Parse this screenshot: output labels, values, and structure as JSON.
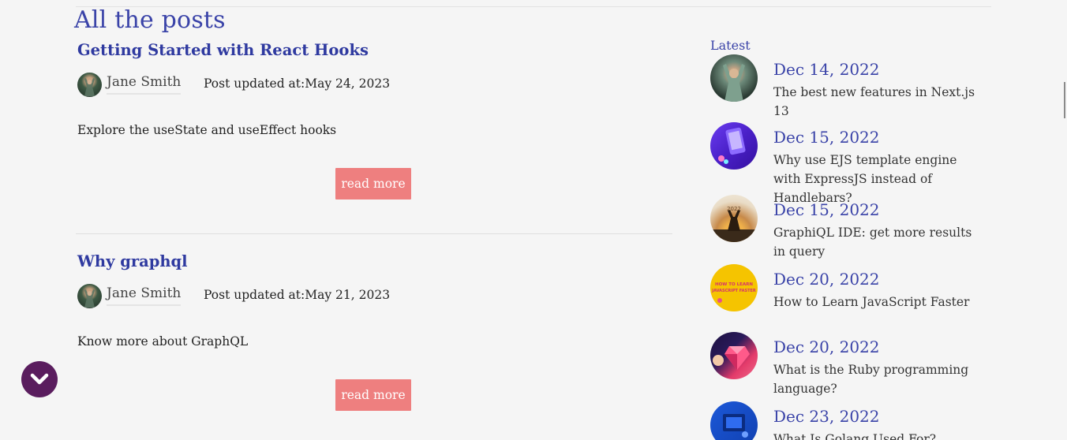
{
  "page": {
    "title": "All the posts"
  },
  "posts": [
    {
      "title": "Getting Started with React Hooks",
      "author": "Jane Smith",
      "updated": "Post updated at:May 24, 2023",
      "excerpt": "Explore the useState and useEffect hooks",
      "button": "read more"
    },
    {
      "title": "Why graphql",
      "author": "Jane Smith",
      "updated": "Post updated at:May 21, 2023",
      "excerpt": "Know more about GraphQL",
      "button": "read more"
    }
  ],
  "sidebar": {
    "label": "Latest",
    "items": [
      {
        "date": "Dec 14, 2022",
        "title": "The best new features in Next.js 13"
      },
      {
        "date": "Dec 15, 2022",
        "title": "Why use EJS template engine with ExpressJS instead of Handlebars?"
      },
      {
        "date": "Dec 15, 2022",
        "title": "GraphiQL IDE: get more results in query"
      },
      {
        "date": "Dec 20, 2022",
        "title": "How to Learn JavaScript Faster"
      },
      {
        "date": "Dec 20, 2022",
        "title": "What is the Ruby programming language?"
      },
      {
        "date": "Dec 23, 2022",
        "title": "What Is Golang Used For?"
      }
    ]
  },
  "thumb_texts": {
    "t3": "2022",
    "t4_line1": "HOW TO LEARN",
    "t4_line2": "JAVASCRIPT FASTER"
  },
  "colors": {
    "accent": "#3a43a8",
    "button": "#ee7f7f",
    "scroll_button": "#5a1d5e",
    "background": "#f5f5f5"
  },
  "icons": {
    "scroll": "chevron-down-icon"
  }
}
